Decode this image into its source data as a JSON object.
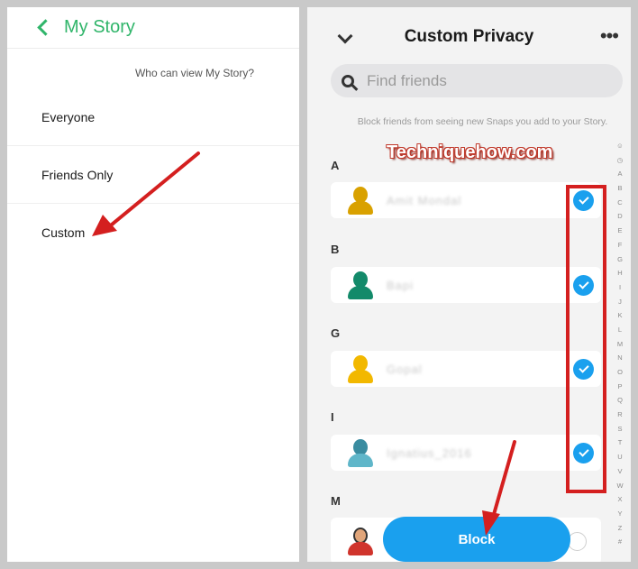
{
  "left_panel": {
    "title": "My Story",
    "question": "Who can view My Story?",
    "options": [
      "Everyone",
      "Friends Only",
      "Custom"
    ]
  },
  "right_panel": {
    "title": "Custom Privacy",
    "more_icon": "•••",
    "search_placeholder": "Find friends",
    "description": "Block friends from seeing new Snaps you add to your Story.",
    "watermark": "Techniquehow.com",
    "sections": [
      {
        "letter": "A",
        "friend": "Amit Mondal",
        "checked": true
      },
      {
        "letter": "B",
        "friend": "Bapi",
        "checked": true
      },
      {
        "letter": "G",
        "friend": "Gopal",
        "checked": true
      },
      {
        "letter": "I",
        "friend": "Ignatius_2016",
        "checked": true
      },
      {
        "letter": "M",
        "friend": "",
        "checked": false
      }
    ],
    "alphabet_index": [
      "☺",
      "◷",
      "A",
      "B",
      "C",
      "D",
      "E",
      "F",
      "G",
      "H",
      "I",
      "J",
      "K",
      "L",
      "M",
      "N",
      "O",
      "P",
      "Q",
      "R",
      "S",
      "T",
      "U",
      "V",
      "W",
      "X",
      "Y",
      "Z",
      "#"
    ],
    "block_button": "Block"
  },
  "colors": {
    "accent_green": "#30b56a",
    "accent_blue": "#1aa0ee",
    "highlight_red": "#d41f1f"
  }
}
